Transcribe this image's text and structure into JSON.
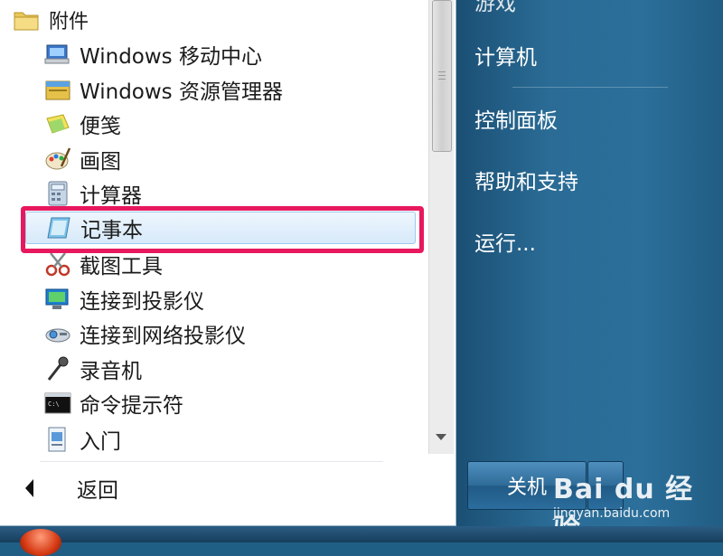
{
  "left_menu": {
    "folder": {
      "label": "附件",
      "icon": "folder-icon"
    },
    "items": [
      {
        "label": "Windows 移动中心",
        "icon": "mobility-center-icon"
      },
      {
        "label": "Windows 资源管理器",
        "icon": "explorer-icon"
      },
      {
        "label": "便笺",
        "icon": "sticky-notes-icon"
      },
      {
        "label": "画图",
        "icon": "paint-icon"
      },
      {
        "label": "计算器",
        "icon": "calculator-icon"
      },
      {
        "label": "记事本",
        "icon": "notepad-icon",
        "selected": true
      },
      {
        "label": "截图工具",
        "icon": "snipping-tool-icon"
      },
      {
        "label": "连接到投影仪",
        "icon": "projector-icon"
      },
      {
        "label": "连接到网络投影仪",
        "icon": "network-projector-icon"
      },
      {
        "label": "录音机",
        "icon": "microphone-icon"
      },
      {
        "label": "命令提示符",
        "icon": "command-prompt-icon"
      },
      {
        "label": "入门",
        "icon": "getting-started-icon"
      }
    ],
    "back_label": "返回"
  },
  "right_menu": {
    "items": [
      {
        "label": "计算机"
      },
      {
        "label": "控制面板"
      },
      {
        "label": "帮助和支持"
      },
      {
        "label": "运行..."
      }
    ],
    "shutdown_label": "关机"
  },
  "watermark": {
    "main": "Bai du 经验",
    "sub": "jingyan.baidu.com"
  },
  "colors": {
    "highlight": "#e8185f",
    "selection": "#d7e9fa",
    "right_pane": "#2a6c96"
  }
}
